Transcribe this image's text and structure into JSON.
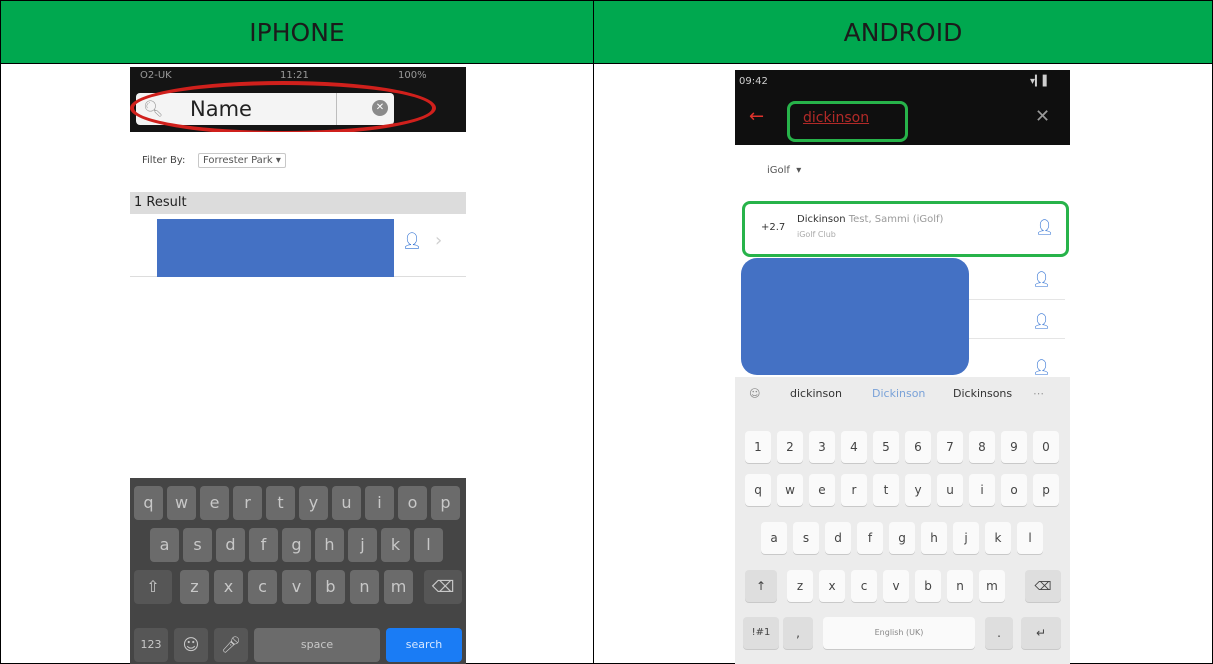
{
  "headers": {
    "left": "IPHONE",
    "right": "ANDROID"
  },
  "iphone": {
    "status": {
      "carrier": "O2-UK",
      "time": "11:21",
      "battery": "100%"
    },
    "search_value": "Name",
    "filter_label": "Filter By:",
    "filter_value": "Forrester Park",
    "results_label": "1 Result",
    "keyboard": {
      "row1": [
        "q",
        "w",
        "e",
        "r",
        "t",
        "y",
        "u",
        "i",
        "o",
        "p"
      ],
      "row2": [
        "a",
        "s",
        "d",
        "f",
        "g",
        "h",
        "j",
        "k",
        "l"
      ],
      "row3": [
        "z",
        "x",
        "c",
        "v",
        "b",
        "n",
        "m"
      ],
      "numbers_key": "123",
      "space_key": "space",
      "action_key": "search"
    },
    "highlight_color": "#d0201c"
  },
  "android": {
    "status": {
      "time": "09:42"
    },
    "search_value": "dickinson",
    "filter_value": "iGolf",
    "result": {
      "handicap": "+2.7",
      "name": "Dickinson",
      "name_rest": "Test, Sammi (iGolf)",
      "club": "iGolf Club"
    },
    "suggestions": [
      "dickinson",
      "Dickinson",
      "Dickinsons"
    ],
    "keyboard": {
      "numbers": [
        "1",
        "2",
        "3",
        "4",
        "5",
        "6",
        "7",
        "8",
        "9",
        "0"
      ],
      "row1": [
        "q",
        "w",
        "e",
        "r",
        "t",
        "y",
        "u",
        "i",
        "o",
        "p"
      ],
      "row2": [
        "a",
        "s",
        "d",
        "f",
        "g",
        "h",
        "j",
        "k",
        "l"
      ],
      "row3": [
        "z",
        "x",
        "c",
        "v",
        "b",
        "n",
        "m"
      ],
      "symbols_key": "!#1",
      "comma_key": ",",
      "space_key": "English (UK)",
      "period_key": "."
    },
    "highlight_color": "#27b34a"
  },
  "accent": {
    "header_bg": "#00a84f",
    "redacted_block": "#4471c4"
  }
}
